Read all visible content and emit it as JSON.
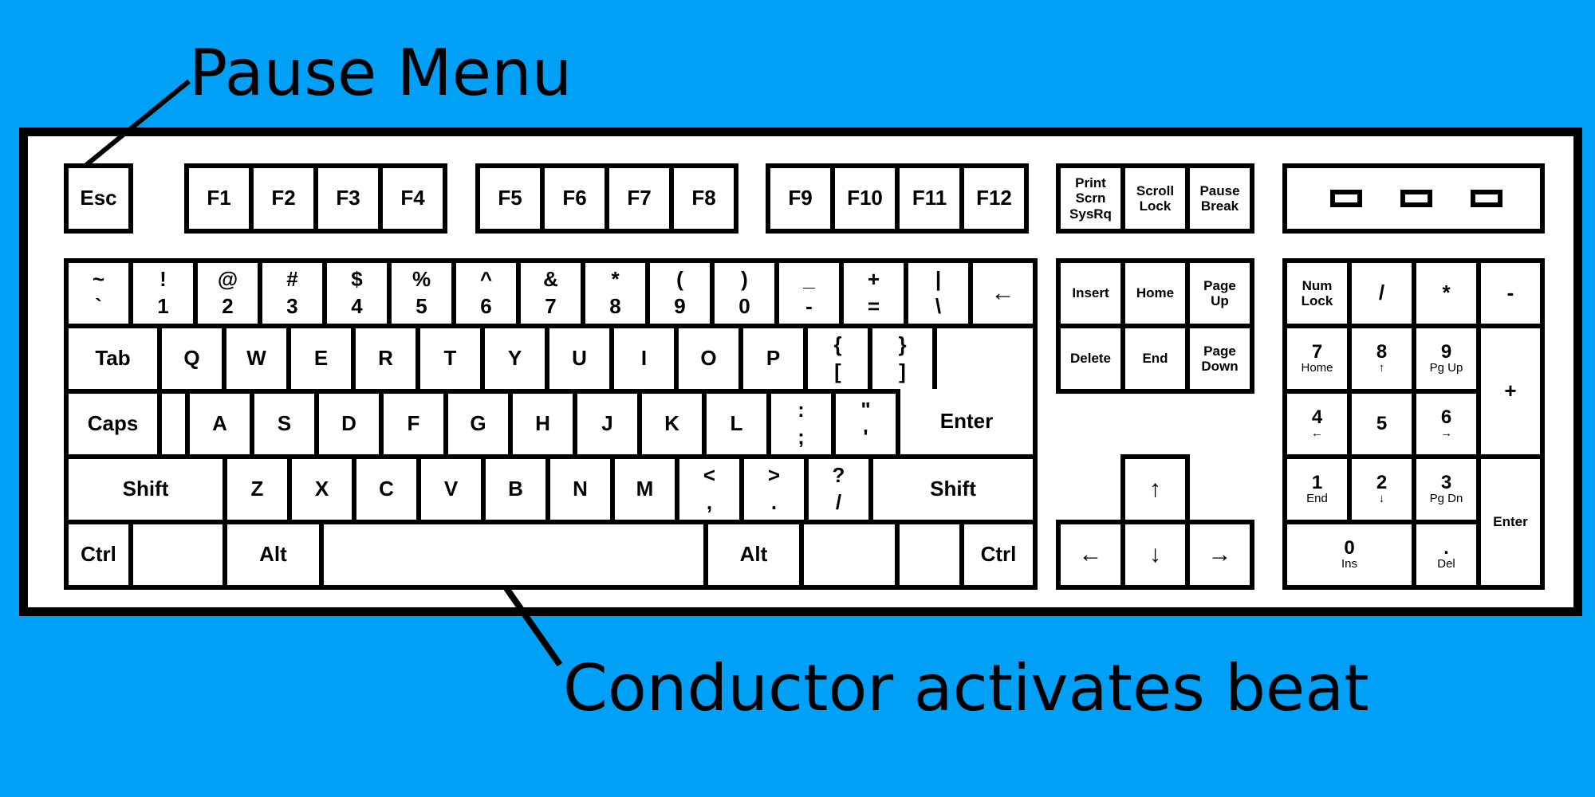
{
  "annotations": {
    "pause_menu": "Pause Menu",
    "conductor": "Conductor activates beat"
  },
  "keys": {
    "esc": "Esc",
    "f1": "F1",
    "f2": "F2",
    "f3": "F3",
    "f4": "F4",
    "f5": "F5",
    "f6": "F6",
    "f7": "F7",
    "f8": "F8",
    "f9": "F9",
    "f10": "F10",
    "f11": "F11",
    "f12": "F12",
    "print_scrn": [
      "Print",
      "Scrn",
      "SysRq"
    ],
    "scroll_lock": [
      "Scroll",
      "Lock"
    ],
    "pause_break": [
      "Pause",
      "Break"
    ],
    "number_row": [
      [
        "~",
        "`"
      ],
      [
        "!",
        "1"
      ],
      [
        "@",
        "2"
      ],
      [
        "#",
        "3"
      ],
      [
        "$",
        "4"
      ],
      [
        "%",
        "5"
      ],
      [
        "^",
        "6"
      ],
      [
        "&",
        "7"
      ],
      [
        "*",
        "8"
      ],
      [
        "(",
        "9"
      ],
      [
        ")",
        "0"
      ],
      [
        "_",
        "-"
      ],
      [
        "+",
        "="
      ],
      [
        "|",
        "\\"
      ]
    ],
    "backspace": "←",
    "tab": "Tab",
    "q": "Q",
    "w": "W",
    "e": "E",
    "r": "R",
    "t": "T",
    "y": "Y",
    "u": "U",
    "i": "I",
    "o": "O",
    "p": "P",
    "brace_left": [
      "{",
      "["
    ],
    "brace_right": [
      "}",
      "]"
    ],
    "caps": "Caps",
    "a": "A",
    "s": "S",
    "d": "D",
    "f": "F",
    "g": "G",
    "h": "H",
    "j": "J",
    "k": "K",
    "l": "L",
    "semicolon": [
      ":",
      ";"
    ],
    "quote": [
      "\"",
      "'"
    ],
    "enter": "Enter",
    "shift_left": "Shift",
    "z": "Z",
    "x": "X",
    "c": "C",
    "v": "V",
    "b": "B",
    "n": "N",
    "m": "M",
    "comma": [
      "<",
      ","
    ],
    "period": [
      ">",
      "."
    ],
    "slash": [
      "?",
      "/"
    ],
    "shift_right": "Shift",
    "ctrl_left": "Ctrl",
    "alt_left": "Alt",
    "alt_right": "Alt",
    "ctrl_right": "Ctrl",
    "insert": "Insert",
    "home": "Home",
    "page_up": [
      "Page",
      "Up"
    ],
    "delete": "Delete",
    "end": "End",
    "page_down": [
      "Page",
      "Down"
    ],
    "arrow_up": "↑",
    "arrow_left": "←",
    "arrow_down": "↓",
    "arrow_right": "→",
    "num_lock": [
      "Num",
      "Lock"
    ],
    "np_slash": "/",
    "np_star": "*",
    "np_minus": "-",
    "np_plus": "+",
    "np7": [
      "7",
      "Home"
    ],
    "np8": [
      "8",
      "↑"
    ],
    "np9": [
      "9",
      "Pg Up"
    ],
    "np4": [
      "4",
      "←"
    ],
    "np5": "5",
    "np6": [
      "6",
      "→"
    ],
    "np1": [
      "1",
      "End"
    ],
    "np2": [
      "2",
      "↓"
    ],
    "np3": [
      "3",
      "Pg Dn"
    ],
    "np_enter": "Enter",
    "np0": [
      "0",
      "Ins"
    ],
    "np_dot": [
      ".",
      "Del"
    ]
  }
}
